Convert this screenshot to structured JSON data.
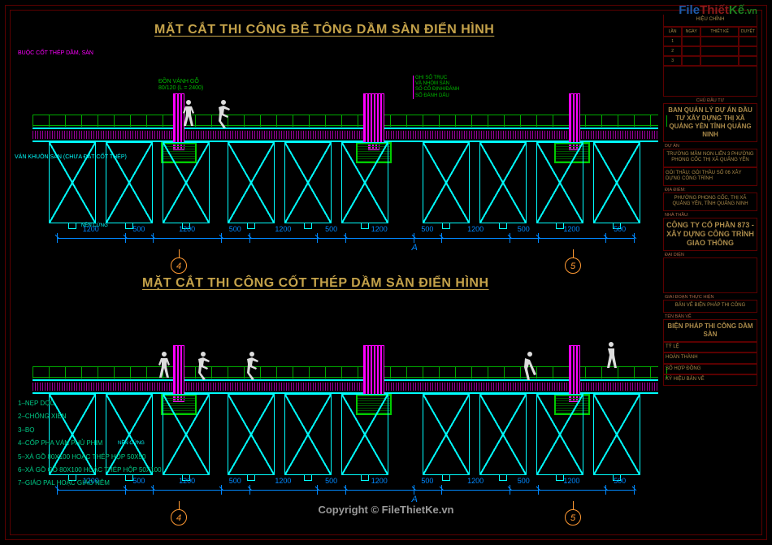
{
  "logo": {
    "p1": "File",
    "p2": "Thiết",
    "p3": "Kế",
    "suffix": ".vn"
  },
  "titles": {
    "top": "MẶT CẮT THI CÔNG BÊ TÔNG DẦM SÀN ĐIỂN HÌNH",
    "bottom": "MẶT CẮT THI CÔNG CỐT THÉP DẦM SÀN ĐIỂN HÌNH"
  },
  "notes": {
    "top_left1": "BUỘC CỐT THÉP DẦM, SÀN",
    "top_left2": "VÁN KHUÔN SÀN (CHƯA ĐẶT CỐT THÉP)",
    "don_vang": "ĐỒN VÁNH GỖ",
    "don_vang2": "80/120 (L = 2400)",
    "ground": "NỀN CỨNG",
    "col_box": [
      "GHI SỐ TRỤC",
      "VÀ NHÓM SÀN",
      "SỐ CỐ ĐỊNH/ĐÁNH",
      "SỐ ĐÁNH DẤU"
    ]
  },
  "dimensions": {
    "seq": [
      "1200",
      "500",
      "1200",
      "500",
      "1200",
      "500",
      "1200",
      "500",
      "1200",
      "500",
      "1200",
      "500"
    ],
    "span_letter": "A"
  },
  "axes": [
    "4",
    "5"
  ],
  "legend": [
    "1–NẸP DỌC",
    "2–CHỐNG XIÊN",
    "3–BỌ",
    "4–CỐP PHA VÁN PHỦ PHIM",
    "5–XÀ GỒ 80X100 HOẶC THÉP HỘP 50X50",
    "6–XÀ GỒ GỖ 80X100 HOẶC THÉP HỘP 50X100",
    "7–GIÁO PAL HOẶC GIÁO NÊM"
  ],
  "title_block": {
    "section_headings": {
      "revisions": "HIỆU CHỈNH",
      "rev_cols": [
        "LẦN",
        "NGÀY",
        "THIẾT KẾ",
        "DUYỆT"
      ],
      "rev_rows": [
        "1",
        "2",
        "3"
      ],
      "client_label": "CHỦ ĐẦU TƯ",
      "client": "BAN QUẢN LÝ DỰ ÁN ĐẦU TƯ XÂY DỰNG THỊ XÃ QUẢNG YÊN TỈNH QUẢNG NINH",
      "project_label": "DỰ ÁN",
      "project": "TRƯỜNG MẦM NON LIÊN 3 PHƯỜNG PHONG CỐC THỊ XÃ QUẢNG YÊN",
      "package_label": "GÓI THẦU:   GÓI THẦU SỐ 06 XÂY DỰNG CÔNG TRÌNH",
      "location_label": "ĐỊA ĐIỂM:",
      "location": "PHƯỜNG PHONG CỐC, THỊ XÃ QUẢNG YÊN, TỈNH QUẢNG NINH",
      "contractor_label": "NHÀ THẦU:",
      "contractor": "CÔNG TY CỔ PHẦN 873 - XÂY DỰNG CÔNG TRÌNH GIAO THÔNG",
      "rep_label": "ĐẠI DIỆN",
      "stage_label": "GIAI ĐOẠN THỰC HIỆN",
      "stage": "BẢN VẼ BIỆN PHÁP THI CÔNG",
      "drawing_label": "TÊN BẢN VẼ",
      "drawing": "BIỆN PHÁP THI CÔNG DẦM SÀN",
      "fields": [
        "TỶ LỆ",
        "HOÀN THÀNH",
        "SỐ HỢP ĐỒNG",
        "KÝ HIỆU BẢN VẼ"
      ]
    }
  },
  "watermark": "Copyright © FileThietKe.vn"
}
